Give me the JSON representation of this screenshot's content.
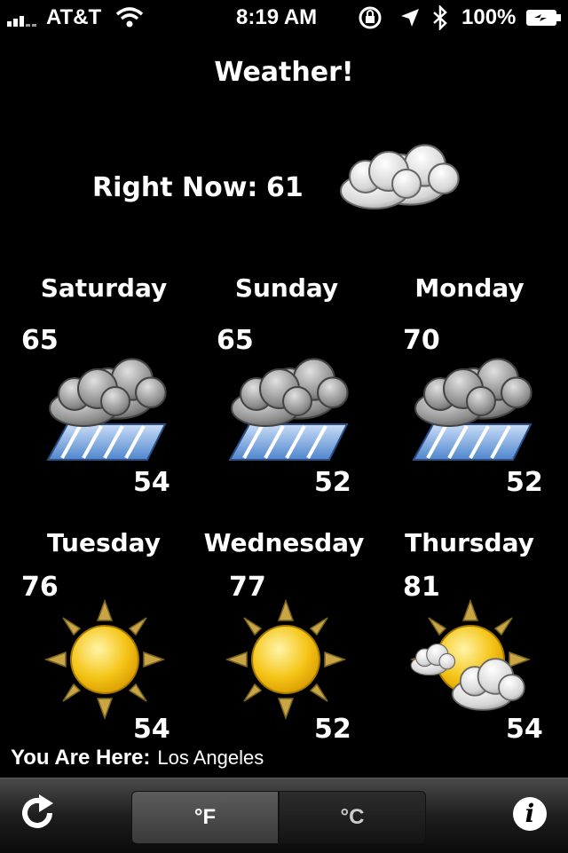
{
  "status_bar": {
    "carrier": "AT&T",
    "time": "8:19 AM",
    "battery": "100%"
  },
  "app_title": "Weather!",
  "current": {
    "label": "Right Now:",
    "temp": "61",
    "icon": "cloudy-icon"
  },
  "forecast": [
    {
      "day": "Saturday",
      "high": "65",
      "low": "54",
      "icon": "rain-icon"
    },
    {
      "day": "Sunday",
      "high": "65",
      "low": "52",
      "icon": "rain-icon"
    },
    {
      "day": "Monday",
      "high": "70",
      "low": "52",
      "icon": "rain-icon"
    },
    {
      "day": "Tuesday",
      "high": "76",
      "low": "54",
      "icon": "sunny-icon"
    },
    {
      "day": "Wednesday",
      "high": "77",
      "low": "52",
      "icon": "sunny-icon"
    },
    {
      "day": "Thursday",
      "high": "81",
      "low": "54",
      "icon": "partly-cloudy-icon"
    }
  ],
  "location": {
    "label": "You Are Here:",
    "value": "Los Angeles"
  },
  "toolbar": {
    "fahrenheit_label": "°F",
    "celsius_label": "°C",
    "selected_unit": "fahrenheit"
  },
  "colors": {
    "background": "#000000",
    "sun": "#f5c518",
    "rain": "#6aa0e0"
  }
}
